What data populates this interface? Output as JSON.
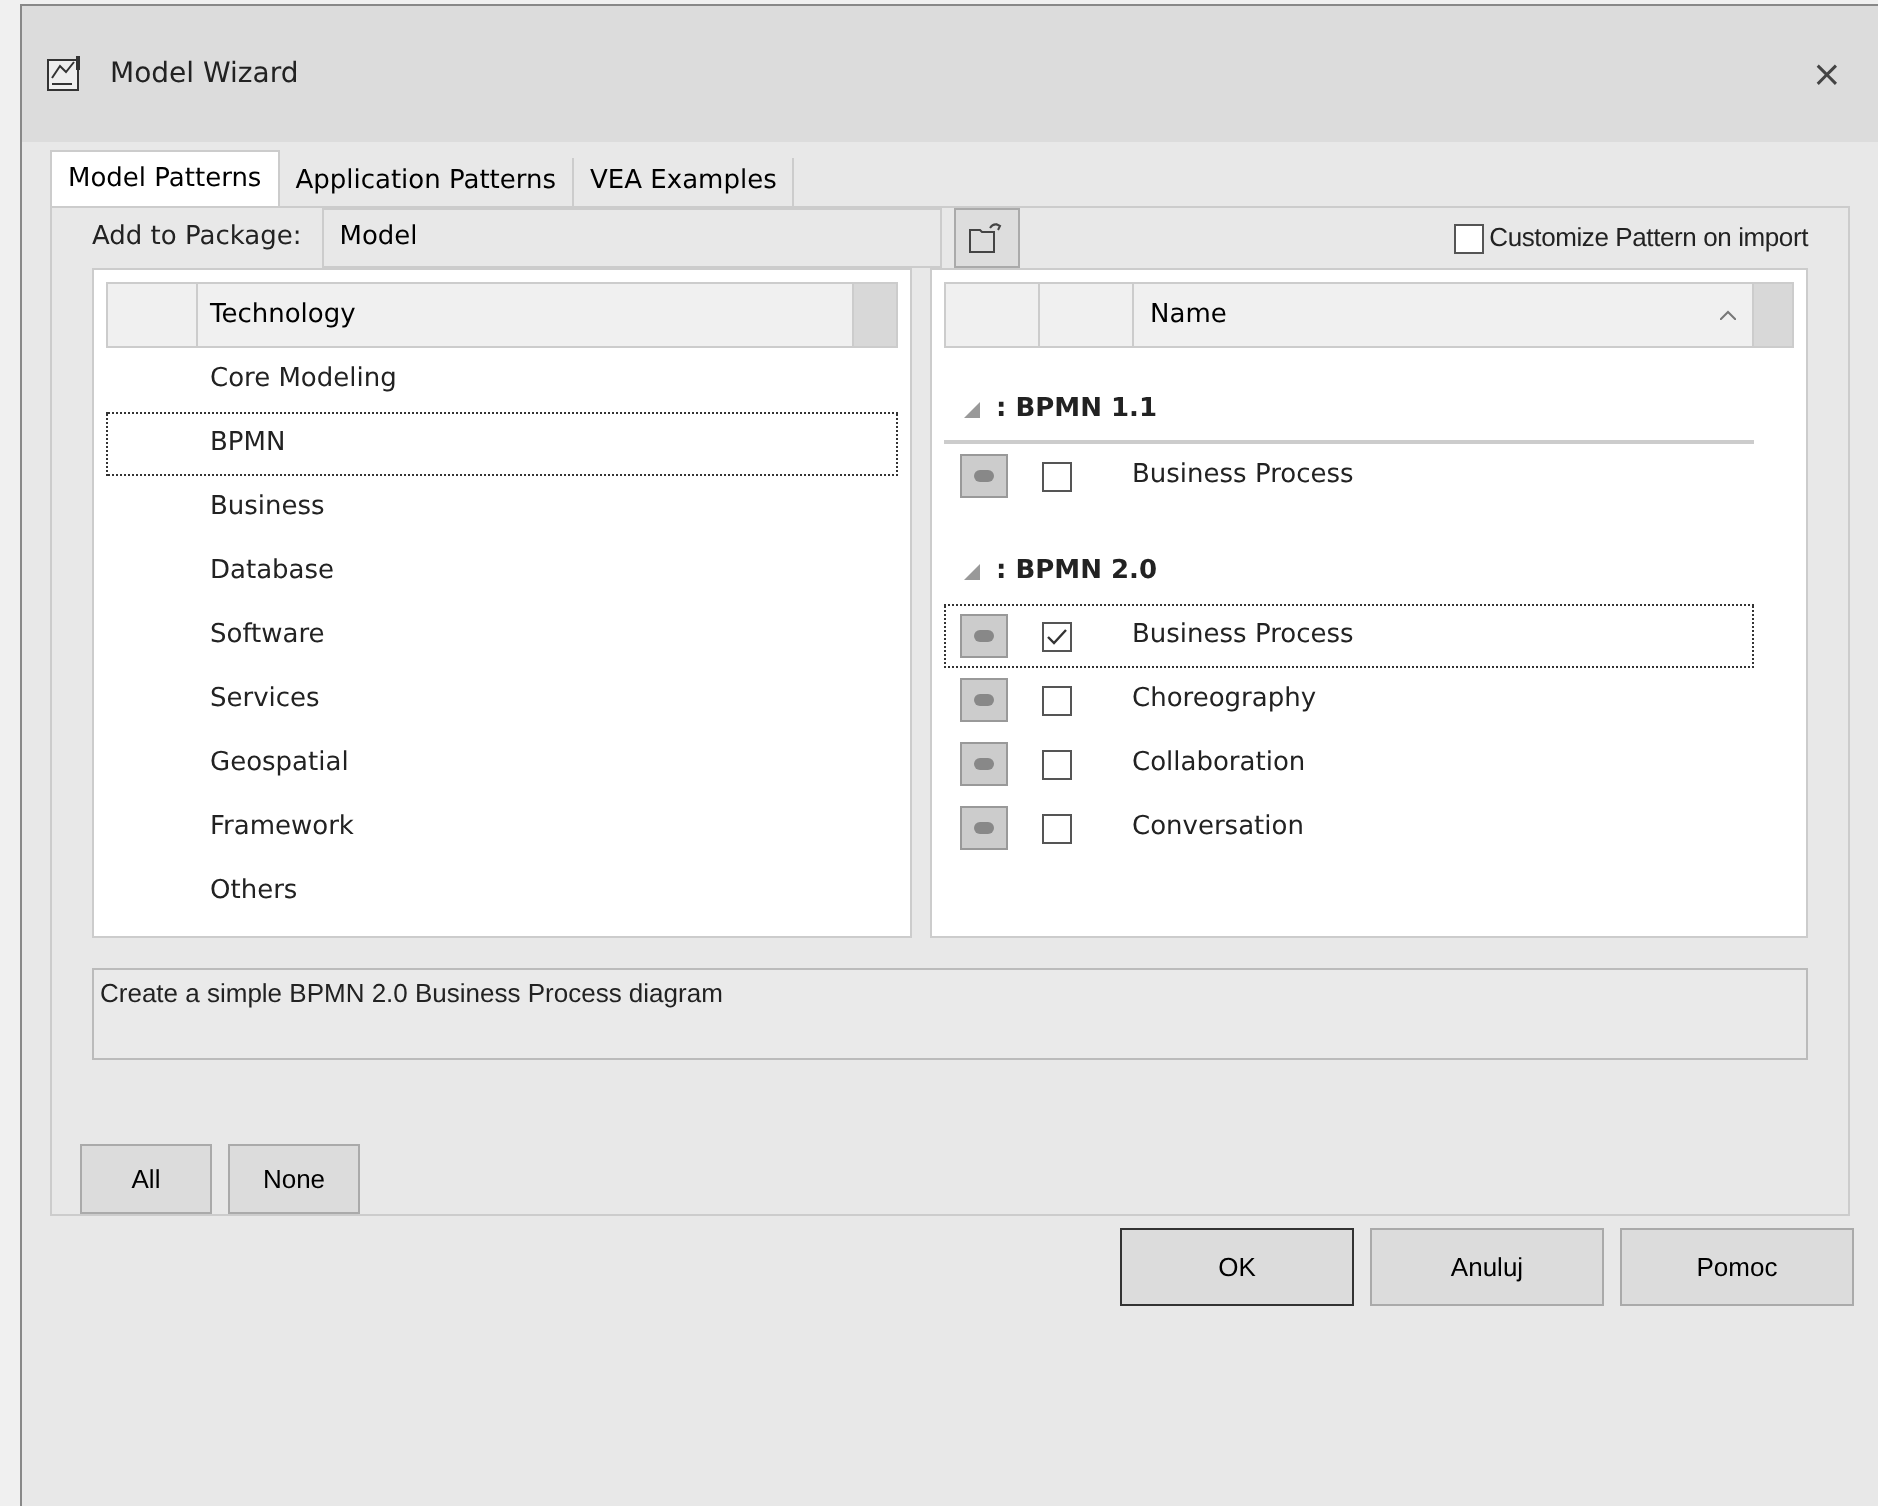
{
  "window": {
    "title": "Model Wizard",
    "close": "×"
  },
  "tabs": [
    {
      "label": "Model Patterns",
      "selected": true
    },
    {
      "label": "Application Patterns",
      "selected": false
    },
    {
      "label": "VEA Examples",
      "selected": false
    }
  ],
  "package": {
    "label": "Add to Package:",
    "value": "Model"
  },
  "customize": {
    "label": "Customize Pattern on import",
    "checked": false
  },
  "technology": {
    "column": "Technology",
    "items": [
      {
        "label": "Core Modeling",
        "selected": false
      },
      {
        "label": "BPMN",
        "selected": true
      },
      {
        "label": "Business",
        "selected": false
      },
      {
        "label": "Database",
        "selected": false
      },
      {
        "label": "Software",
        "selected": false
      },
      {
        "label": "Services",
        "selected": false
      },
      {
        "label": "Geospatial",
        "selected": false
      },
      {
        "label": "Framework",
        "selected": false
      },
      {
        "label": "Others",
        "selected": false
      }
    ]
  },
  "patterns": {
    "column": "Name",
    "groups": [
      {
        "title": ": BPMN 1.1",
        "expanded": true,
        "items": [
          {
            "name": "Business Process",
            "checked": false,
            "selected": false
          }
        ]
      },
      {
        "title": ": BPMN 2.0",
        "expanded": true,
        "items": [
          {
            "name": "Business Process",
            "checked": true,
            "selected": true
          },
          {
            "name": "Choreography",
            "checked": false,
            "selected": false
          },
          {
            "name": "Collaboration",
            "checked": false,
            "selected": false
          },
          {
            "name": "Conversation",
            "checked": false,
            "selected": false
          }
        ]
      }
    ]
  },
  "description": "Create a simple BPMN 2.0 Business Process diagram",
  "select_buttons": [
    "All",
    "None"
  ],
  "buttons": [
    "OK",
    "Anuluj",
    "Pomoc"
  ]
}
